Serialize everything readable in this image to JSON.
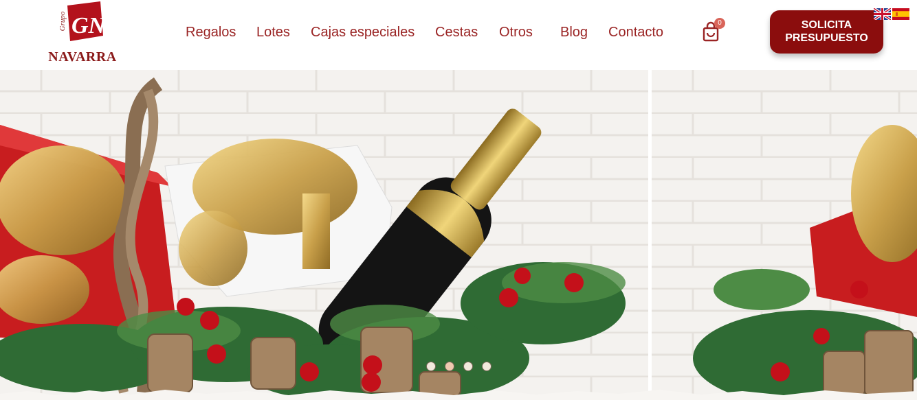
{
  "logo": {
    "name": "NAVARRA",
    "grupo": "Grupo",
    "mark": "GN"
  },
  "nav": {
    "items": [
      {
        "label": "Regalos"
      },
      {
        "label": "Lotes"
      },
      {
        "label": "Cajas especiales"
      },
      {
        "label": "Cestas"
      },
      {
        "label": "Otros"
      },
      {
        "label": "Blog"
      },
      {
        "label": "Contacto"
      }
    ]
  },
  "cart": {
    "count": "0",
    "icon": "shopping-bag-icon"
  },
  "cta": {
    "label": "Solicita presupuesto"
  },
  "languages": [
    {
      "code": "en",
      "icon": "uk-flag-icon"
    },
    {
      "code": "es",
      "icon": "spain-flag-icon"
    }
  ],
  "slider": {
    "slides": 4,
    "active": 2
  },
  "colors": {
    "brand": "#8b0d0d",
    "nav": "#9a2424",
    "badge": "#d9655a"
  }
}
